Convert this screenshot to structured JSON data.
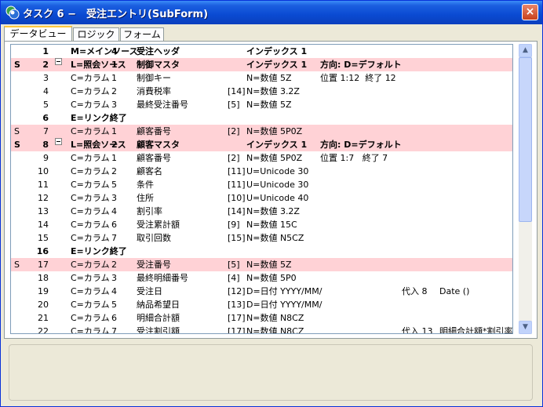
{
  "window": {
    "title": "タスク 6 −　受注エントリ(SubForm)",
    "close_label": "×"
  },
  "tabs": [
    {
      "label": "データビュー",
      "active": true
    },
    {
      "label": "ロジック",
      "active": false
    },
    {
      "label": "フォーム",
      "active": false
    }
  ],
  "rows": [
    {
      "flag": "",
      "num": "1",
      "type": "M=メインソース",
      "idx": "4",
      "name": "受注ヘッダ",
      "size": "",
      "field": "インデックス 1",
      "extra": "",
      "assign": "",
      "expr": "",
      "bold": true
    },
    {
      "flag": "S",
      "num": "2",
      "type": "L=照会ソース",
      "idx": "1",
      "name": "制御マスタ",
      "size": "",
      "field": "インデックス 1",
      "extra": "方向: D=デフォルト",
      "assign": "",
      "expr": "",
      "bold": true,
      "pink": true,
      "expander": true
    },
    {
      "flag": "",
      "num": "3",
      "type": "C=カラム",
      "idx": "1",
      "name": "制御キー",
      "size": "",
      "field": "N=数値 5Z",
      "extra": "位置 1:12  終了 12",
      "assign": "",
      "expr": ""
    },
    {
      "flag": "",
      "num": "4",
      "type": "C=カラム",
      "idx": "2",
      "name": "消費税率",
      "size": "[14]",
      "field": "N=数値 3.2Z",
      "extra": "",
      "assign": "",
      "expr": ""
    },
    {
      "flag": "",
      "num": "5",
      "type": "C=カラム",
      "idx": "3",
      "name": "最終受注番号",
      "size": "[5]",
      "field": "N=数値 5Z",
      "extra": "",
      "assign": "",
      "expr": ""
    },
    {
      "flag": "",
      "num": "6",
      "type": "E=リンク終了",
      "idx": "",
      "name": "",
      "size": "",
      "field": "",
      "extra": "",
      "assign": "",
      "expr": "",
      "bold": true
    },
    {
      "flag": "S",
      "num": "7",
      "type": "C=カラム",
      "idx": "1",
      "name": "顧客番号",
      "size": "[2]",
      "field": "N=数値 5P0Z",
      "extra": "",
      "assign": "",
      "expr": "",
      "pink": true
    },
    {
      "flag": "S",
      "num": "8",
      "type": "L=照会ソース",
      "idx": "2",
      "name": "顧客マスタ",
      "size": "",
      "field": "インデックス 1",
      "extra": "方向: D=デフォルト",
      "assign": "",
      "expr": "",
      "bold": true,
      "pink": true,
      "expander": true
    },
    {
      "flag": "",
      "num": "9",
      "type": "C=カラム",
      "idx": "1",
      "name": "顧客番号",
      "size": "[2]",
      "field": "N=数値 5P0Z",
      "extra": "位置 1:7   終了 7",
      "assign": "",
      "expr": ""
    },
    {
      "flag": "",
      "num": "10",
      "type": "C=カラム",
      "idx": "2",
      "name": "顧客名",
      "size": "[11]",
      "field": "U=Unicode 30",
      "extra": "",
      "assign": "",
      "expr": ""
    },
    {
      "flag": "",
      "num": "11",
      "type": "C=カラム",
      "idx": "5",
      "name": "条件",
      "size": "[11]",
      "field": "U=Unicode 30",
      "extra": "",
      "assign": "",
      "expr": ""
    },
    {
      "flag": "",
      "num": "12",
      "type": "C=カラム",
      "idx": "3",
      "name": "住所",
      "size": "[10]",
      "field": "U=Unicode 40",
      "extra": "",
      "assign": "",
      "expr": ""
    },
    {
      "flag": "",
      "num": "13",
      "type": "C=カラム",
      "idx": "4",
      "name": "割引率",
      "size": "[14]",
      "field": "N=数値 3.2Z",
      "extra": "",
      "assign": "",
      "expr": ""
    },
    {
      "flag": "",
      "num": "14",
      "type": "C=カラム",
      "idx": "6",
      "name": "受注累計額",
      "size": "[9]",
      "field": "N=数値 15C",
      "extra": "",
      "assign": "",
      "expr": ""
    },
    {
      "flag": "",
      "num": "15",
      "type": "C=カラム",
      "idx": "7",
      "name": "取引回数",
      "size": "[15]",
      "field": "N=数値 N5CZ",
      "extra": "",
      "assign": "",
      "expr": ""
    },
    {
      "flag": "",
      "num": "16",
      "type": "E=リンク終了",
      "idx": "",
      "name": "",
      "size": "",
      "field": "",
      "extra": "",
      "assign": "",
      "expr": "",
      "bold": true
    },
    {
      "flag": "S",
      "num": "17",
      "type": "C=カラム",
      "idx": "2",
      "name": "受注番号",
      "size": "[5]",
      "field": "N=数値 5Z",
      "extra": "",
      "assign": "",
      "expr": "",
      "pink": true
    },
    {
      "flag": "",
      "num": "18",
      "type": "C=カラム",
      "idx": "3",
      "name": "最終明細番号",
      "size": "[4]",
      "field": "N=数値 5P0",
      "extra": "",
      "assign": "",
      "expr": ""
    },
    {
      "flag": "",
      "num": "19",
      "type": "C=カラム",
      "idx": "4",
      "name": "受注日",
      "size": "[12]",
      "field": "D=日付 YYYY/MM/",
      "extra": "",
      "assign": "代入 8",
      "expr": "Date ()"
    },
    {
      "flag": "",
      "num": "20",
      "type": "C=カラム",
      "idx": "5",
      "name": "納品希望日",
      "size": "[13]",
      "field": "D=日付 YYYY/MM/",
      "extra": "",
      "assign": "",
      "expr": ""
    },
    {
      "flag": "",
      "num": "21",
      "type": "C=カラム",
      "idx": "6",
      "name": "明細合計額",
      "size": "[17]",
      "field": "N=数値 N8CZ",
      "extra": "",
      "assign": "",
      "expr": ""
    },
    {
      "flag": "",
      "num": "22",
      "type": "C=カラム",
      "idx": "7",
      "name": "受注割引額",
      "size": "[17]",
      "field": "N=数値 N8CZ",
      "extra": "",
      "assign": "代入 13",
      "expr": "明細合計額*割引率"
    }
  ],
  "scrollbar": {
    "up_icon": "▲",
    "down_icon": "▼"
  },
  "colors": {
    "highlight_row": "#ffd2d6",
    "title_bar": "#0a4ad2",
    "close_button": "#c8411b"
  }
}
